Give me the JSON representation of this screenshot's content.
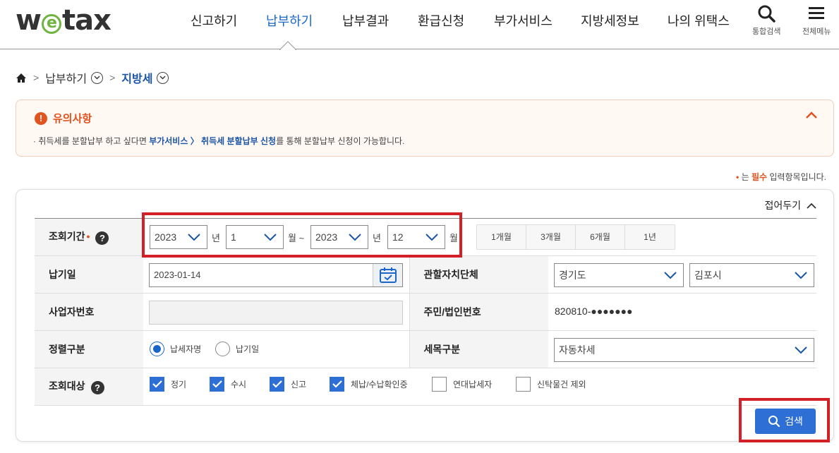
{
  "header": {
    "logo": {
      "prefix": "w",
      "e": "e",
      "suffix": "tax"
    },
    "nav": [
      "신고하기",
      "납부하기",
      "납부결과",
      "환급신청",
      "부가서비스",
      "지방세정보",
      "나의 위택스"
    ],
    "active_nav": "납부하기",
    "search_label": "통합검색",
    "menu_label": "전체메뉴"
  },
  "breadcrumb": {
    "level1": "납부하기",
    "level2": "지방세"
  },
  "notice": {
    "title": "유의사항",
    "text_before": "· 취득세를 분할납부 하고 싶다면 ",
    "text_link": "부가서비스 〉 취득세 분할납부 신청",
    "text_after": "를 통해 분할납부 신청이 가능합니다."
  },
  "required_note": {
    "dot": "•",
    "before": "는 ",
    "req": "필수",
    "after": " 입력항목입니다."
  },
  "panel": {
    "fold_label": "접어두기",
    "period": {
      "label": "조회기간",
      "required_mark": "•",
      "help": "?",
      "start_year": "2023",
      "year_unit": "년",
      "start_month": "1",
      "month_unit_tilde": "월 ~",
      "end_year": "2023",
      "year_unit2": "년",
      "end_month": "12",
      "month_unit": "월",
      "quick": [
        "1개월",
        "3개월",
        "6개월",
        "1년"
      ]
    },
    "pay_date": {
      "label": "납기일",
      "value": "2023-01-14"
    },
    "jurisdiction": {
      "label": "관할자치단체",
      "province": "경기도",
      "city": "김포시"
    },
    "biz_no": {
      "label": "사업자번호",
      "value": ""
    },
    "resident_no": {
      "label": "주민/법인번호",
      "value": "820810-●●●●●●●"
    },
    "sort": {
      "label": "정렬구분",
      "options": [
        "납세자명",
        "납기일"
      ],
      "selected": "납세자명"
    },
    "tax_item": {
      "label": "세목구분",
      "value": "자동차세"
    },
    "target": {
      "label": "조회대상",
      "help": "?",
      "options": [
        {
          "label": "정기",
          "checked": true
        },
        {
          "label": "수시",
          "checked": true
        },
        {
          "label": "신고",
          "checked": true
        },
        {
          "label": "체납/수납확인중",
          "checked": true
        },
        {
          "label": "연대납세자",
          "checked": false
        },
        {
          "label": "신탁물건 제외",
          "checked": false
        }
      ]
    },
    "search_button": "검색"
  },
  "colors": {
    "accent": "#1a66c9",
    "button": "#2e6fd6",
    "warning": "#e2531f",
    "highlight": "#d31f26"
  }
}
